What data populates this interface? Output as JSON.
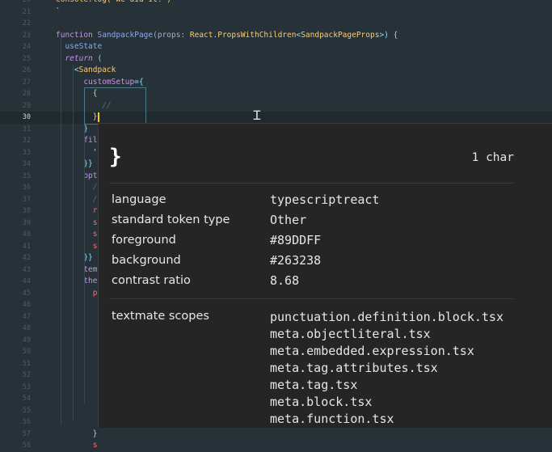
{
  "editor": {
    "cursor_line": "30",
    "lines": [
      {
        "num": "20",
        "tokens": [
          {
            "t": "console.log('We did it!')",
            "c": "#ffcb6b"
          }
        ]
      },
      {
        "num": "21",
        "tokens": [
          {
            "t": "`",
            "c": "#c3e88d"
          }
        ]
      },
      {
        "num": "22",
        "tokens": []
      },
      {
        "num": "23",
        "tokens": [
          {
            "t": "function ",
            "c": "#c792ea"
          },
          {
            "t": "SandpackPage",
            "c": "#82aaff"
          },
          {
            "t": "(props: ",
            "c": "#a6accd"
          },
          {
            "t": "React",
            "c": "#ffcb6b"
          },
          {
            "t": ".",
            "c": "#89ddff"
          },
          {
            "t": "PropsWithChildren",
            "c": "#ffcb6b"
          },
          {
            "t": "<",
            "c": "#89ddff"
          },
          {
            "t": "SandpackPageProps",
            "c": "#ffcb6b"
          },
          {
            "t": ">) {",
            "c": "#89ddff"
          }
        ]
      },
      {
        "num": "24",
        "tokens": [
          {
            "t": "  useState",
            "c": "#82aaff"
          }
        ]
      },
      {
        "num": "25",
        "tokens": [
          {
            "t": "  return",
            "c": "#c792ea",
            "i": true
          },
          {
            "t": " (",
            "c": "#89ddff"
          }
        ]
      },
      {
        "num": "26",
        "tokens": [
          {
            "t": "    <",
            "c": "#89ddff"
          },
          {
            "t": "Sandpack",
            "c": "#ffcb6b"
          }
        ]
      },
      {
        "num": "27",
        "tokens": [
          {
            "t": "      customSetup",
            "c": "#c792ea"
          },
          {
            "t": "={",
            "c": "#89ddff"
          }
        ]
      },
      {
        "num": "28",
        "tokens": [
          {
            "t": "        {",
            "c": "#ffcb6b"
          }
        ]
      },
      {
        "num": "29",
        "tokens": [
          {
            "t": "          //",
            "c": "#546e7a",
            "i": true
          }
        ]
      },
      {
        "num": "30",
        "tokens": [
          {
            "t": "        }",
            "c": "#ffcb6b"
          }
        ]
      },
      {
        "num": "31",
        "tokens": [
          {
            "t": "      }",
            "c": "#89ddff"
          }
        ]
      },
      {
        "num": "32",
        "tokens": [
          {
            "t": "      fil",
            "c": "#c792ea"
          }
        ]
      },
      {
        "num": "33",
        "tokens": [
          {
            "t": "        '",
            "c": "#c3e88d"
          }
        ]
      },
      {
        "num": "34",
        "tokens": [
          {
            "t": "      }}",
            "c": "#89ddff"
          }
        ]
      },
      {
        "num": "35",
        "tokens": [
          {
            "t": "      opt",
            "c": "#c792ea"
          }
        ]
      },
      {
        "num": "36",
        "tokens": [
          {
            "t": "        /",
            "c": "#546e7a",
            "i": true
          }
        ]
      },
      {
        "num": "37",
        "tokens": [
          {
            "t": "        /",
            "c": "#546e7a",
            "i": true
          }
        ]
      },
      {
        "num": "38",
        "tokens": [
          {
            "t": "        r",
            "c": "#f07178"
          }
        ]
      },
      {
        "num": "39",
        "tokens": [
          {
            "t": "        s",
            "c": "#f07178"
          }
        ]
      },
      {
        "num": "40",
        "tokens": [
          {
            "t": "        s",
            "c": "#f07178"
          }
        ]
      },
      {
        "num": "41",
        "tokens": [
          {
            "t": "        s",
            "c": "#f07178"
          }
        ]
      },
      {
        "num": "42",
        "tokens": [
          {
            "t": "      }}",
            "c": "#89ddff"
          }
        ]
      },
      {
        "num": "43",
        "tokens": [
          {
            "t": "      tem",
            "c": "#c792ea"
          }
        ]
      },
      {
        "num": "44",
        "tokens": [
          {
            "t": "      the",
            "c": "#c792ea"
          }
        ]
      },
      {
        "num": "45",
        "tokens": [
          {
            "t": "        p",
            "c": "#f07178"
          }
        ]
      },
      {
        "num": "46",
        "tokens": []
      },
      {
        "num": "47",
        "tokens": []
      },
      {
        "num": "48",
        "tokens": []
      },
      {
        "num": "49",
        "tokens": []
      },
      {
        "num": "50",
        "tokens": []
      },
      {
        "num": "51",
        "tokens": []
      },
      {
        "num": "52",
        "tokens": []
      },
      {
        "num": "53",
        "tokens": []
      },
      {
        "num": "54",
        "tokens": []
      },
      {
        "num": "55",
        "tokens": []
      },
      {
        "num": "56",
        "tokens": []
      },
      {
        "num": "57",
        "tokens": [
          {
            "t": "        }",
            "c": "#89ddff"
          }
        ]
      },
      {
        "num": "58",
        "tokens": [
          {
            "t": "        s",
            "c": "#f07178"
          }
        ]
      }
    ]
  },
  "hover": {
    "char": "}",
    "length": "1 char",
    "rows": [
      {
        "key": "language",
        "value": "typescriptreact"
      },
      {
        "key": "standard token type",
        "value": "Other"
      },
      {
        "key": "foreground",
        "value": "#89DDFF"
      },
      {
        "key": "background",
        "value": "#263238"
      },
      {
        "key": "contrast ratio",
        "value": "8.68"
      }
    ],
    "scopes_label": "textmate scopes",
    "scopes": [
      "punctuation.definition.block.tsx",
      "meta.objectliteral.tsx",
      "meta.embedded.expression.tsx",
      "meta.tag.attributes.tsx",
      "meta.tag.tsx",
      "meta.block.tsx",
      "meta.function.tsx"
    ]
  }
}
